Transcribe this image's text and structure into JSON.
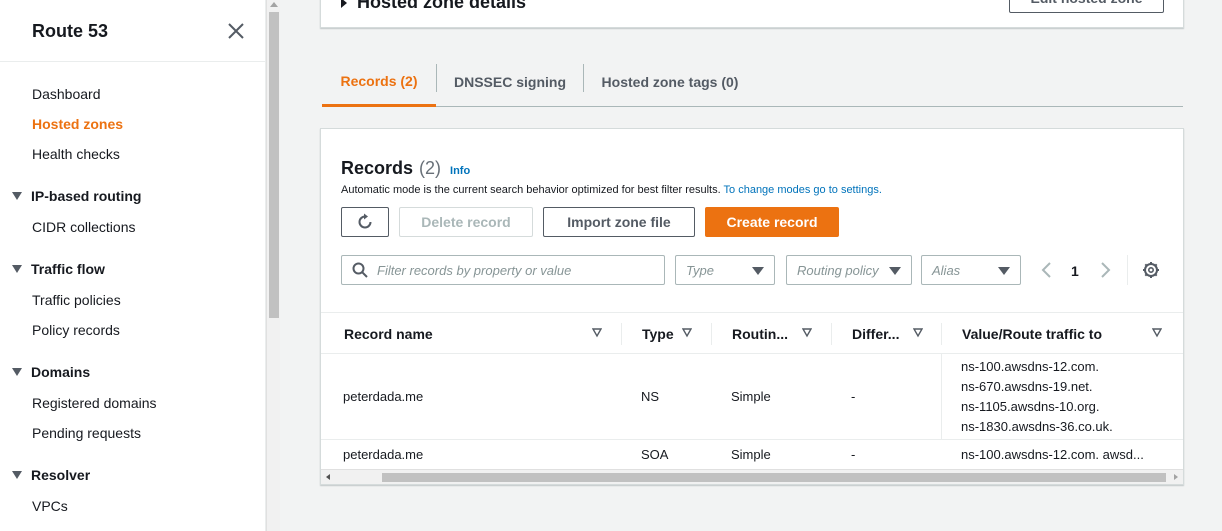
{
  "sidebar": {
    "title": "Route 53",
    "links_top": [
      "Dashboard",
      "Hosted zones",
      "Health checks"
    ],
    "sections": [
      {
        "label": "IP-based routing",
        "items": [
          "CIDR collections"
        ]
      },
      {
        "label": "Traffic flow",
        "items": [
          "Traffic policies",
          "Policy records"
        ]
      },
      {
        "label": "Domains",
        "items": [
          "Registered domains",
          "Pending requests"
        ]
      },
      {
        "label": "Resolver",
        "items": [
          "VPCs"
        ]
      }
    ]
  },
  "hosted_zone": {
    "details_label": "Hosted zone details",
    "edit_label": "Edit hosted zone"
  },
  "tabs": [
    "Records (2)",
    "DNSSEC signing",
    "Hosted zone tags (0)"
  ],
  "records": {
    "title": "Records",
    "count": "(2)",
    "info": "Info",
    "description": "Automatic mode is the current search behavior optimized for best filter results.",
    "description_link": "To change modes go to settings.",
    "buttons": {
      "delete": "Delete record",
      "import": "Import zone file",
      "create": "Create record"
    },
    "search_placeholder": "Filter records by property or value",
    "filters": [
      "Type",
      "Routing policy",
      "Alias"
    ],
    "page": "1",
    "columns": [
      "Record name",
      "Type",
      "Routin...",
      "Differ...",
      "Value/Route traffic to"
    ],
    "rows": [
      {
        "name": "peterdada.me",
        "type": "NS",
        "routing": "Simple",
        "differentiator": "-",
        "values": [
          "ns-100.awsdns-12.com.",
          "ns-670.awsdns-19.net.",
          "ns-1105.awsdns-10.org.",
          "ns-1830.awsdns-36.co.uk."
        ]
      },
      {
        "name": "peterdada.me",
        "type": "SOA",
        "routing": "Simple",
        "differentiator": "-",
        "values": [
          "ns-100.awsdns-12.com. awsd..."
        ]
      }
    ]
  },
  "colors": {
    "accent": "#ec7211",
    "link": "#0073bb",
    "text": "#16191f",
    "background": "#f2f3f3"
  }
}
